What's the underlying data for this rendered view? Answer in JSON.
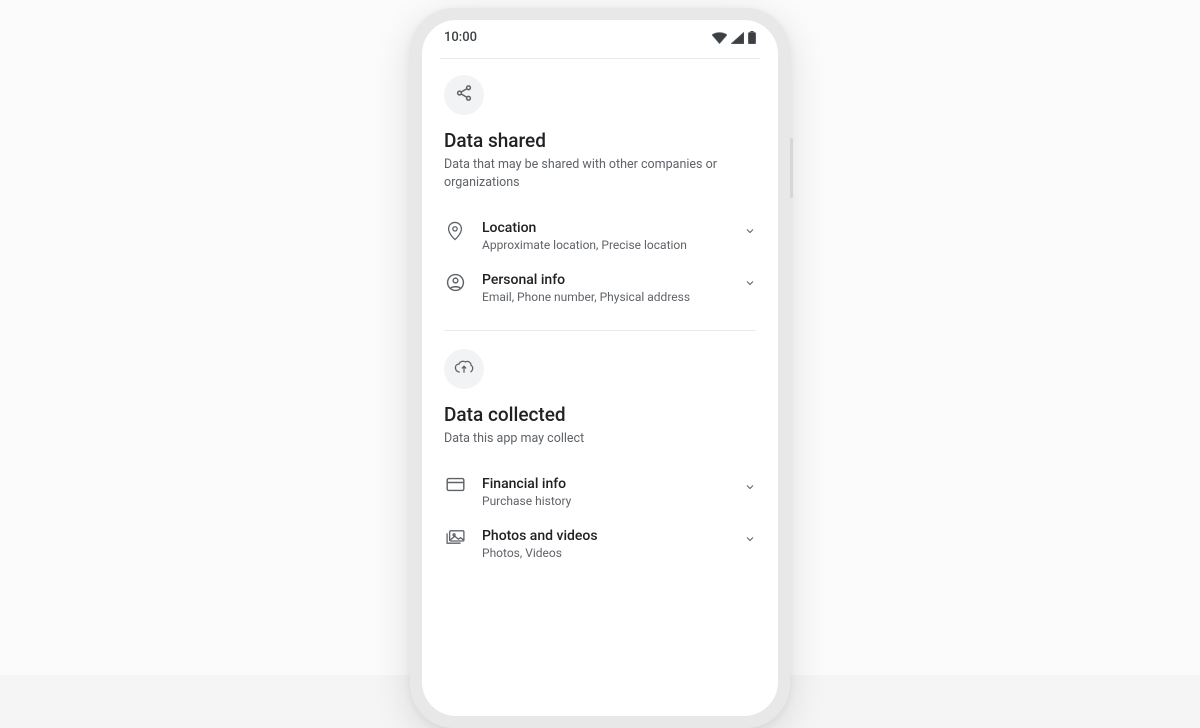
{
  "status": {
    "time": "10:00"
  },
  "sections": {
    "shared": {
      "title": "Data shared",
      "subtitle": "Data that may be shared with other companies or organizations",
      "rows": [
        {
          "title": "Location",
          "subtitle": "Approximate location, Precise location"
        },
        {
          "title": "Personal info",
          "subtitle": "Email, Phone number, Physical address"
        }
      ]
    },
    "collected": {
      "title": "Data collected",
      "subtitle": "Data this app may collect",
      "rows": [
        {
          "title": "Financial info",
          "subtitle": "Purchase history"
        },
        {
          "title": "Photos and videos",
          "subtitle": "Photos, Videos"
        }
      ]
    }
  }
}
